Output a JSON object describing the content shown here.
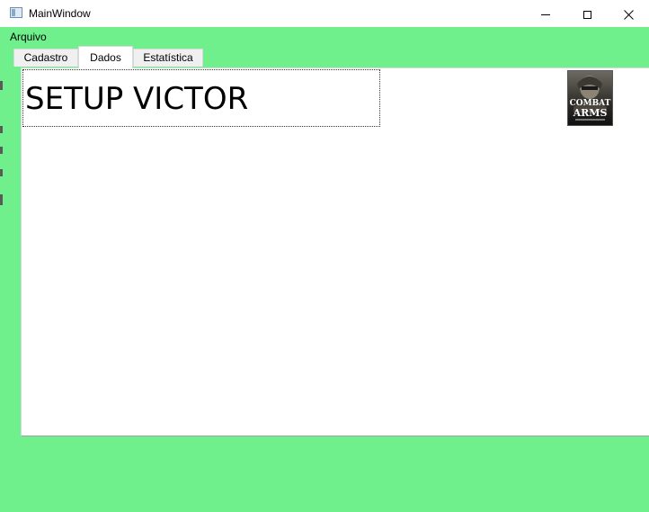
{
  "window": {
    "title": "MainWindow",
    "icon": "app-window-icon",
    "caption_icons": [
      "minimize-icon",
      "maximize-icon",
      "close-icon"
    ]
  },
  "menu": {
    "items": [
      {
        "label": "Arquivo"
      }
    ]
  },
  "tabs": [
    {
      "label": "Cadastro",
      "active": false
    },
    {
      "label": "Dados",
      "active": true
    },
    {
      "label": "Estatística",
      "active": false
    }
  ],
  "content": {
    "text_value": "SETUP VICTOR",
    "image": {
      "name": "combat-arms-logo",
      "lines": [
        "COMBAT",
        "ARMS"
      ]
    }
  },
  "colors": {
    "window_background": "#6ff08c",
    "panel_background": "#ffffff",
    "title_bar": "#ffffff"
  }
}
